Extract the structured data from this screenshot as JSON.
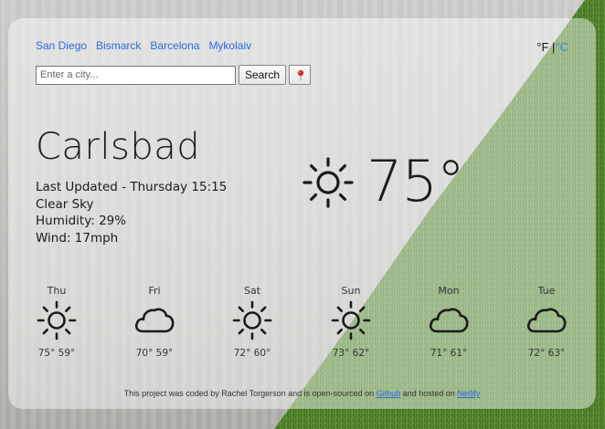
{
  "nav": {
    "cities": [
      "San Diego",
      "Bismarck",
      "Barcelona",
      "Mykolaiv"
    ]
  },
  "units": {
    "fahrenheit": "°F",
    "separator": "|",
    "celsius": "°C",
    "active": "fahrenheit"
  },
  "search": {
    "placeholder": "Enter a city...",
    "value": "",
    "button_label": "Search",
    "location_icon": "map-pin-icon"
  },
  "current": {
    "city": "Carlsbad",
    "last_updated": "Last Updated - Thursday 15:15",
    "description": "Clear Sky",
    "humidity": "Humidity: 29%",
    "wind": "Wind: 17mph",
    "temperature": "75°",
    "icon": "sun-icon"
  },
  "forecast": [
    {
      "day": "Thu",
      "icon": "sun-icon",
      "temps": "75° 59°"
    },
    {
      "day": "Fri",
      "icon": "cloud-icon",
      "temps": "70° 59°"
    },
    {
      "day": "Sat",
      "icon": "sun-icon",
      "temps": "72° 60°"
    },
    {
      "day": "Sun",
      "icon": "sun-icon",
      "temps": "73° 62°"
    },
    {
      "day": "Mon",
      "icon": "cloud-icon",
      "temps": "71° 61°"
    },
    {
      "day": "Tue",
      "icon": "cloud-icon",
      "temps": "72° 63°"
    }
  ],
  "footer": {
    "text_before": "This project was coded by Rachel Torgerson and is open-sourced on",
    "github_label": "Github",
    "text_middle": "and hosted on",
    "netlify_label": "Netlify"
  },
  "colors": {
    "link": "#2b6be0",
    "celsius_active": "#2b8fd6",
    "card_overlay": "rgba(255,255,255,0.45)",
    "grass": "#4e7f2c"
  }
}
